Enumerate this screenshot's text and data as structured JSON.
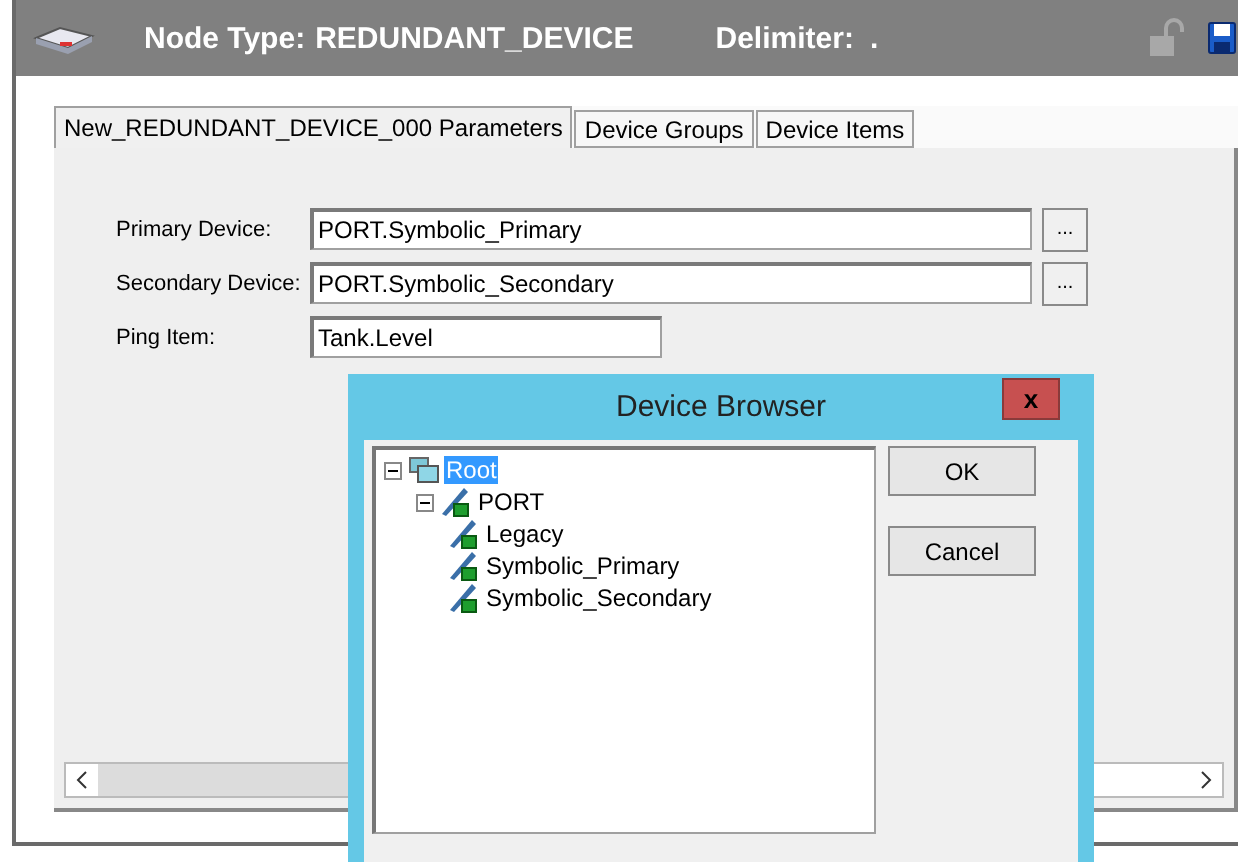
{
  "header": {
    "node_type_label": "Node Type:",
    "node_type": "REDUNDANT_DEVICE",
    "delimiter_label": "Delimiter:",
    "delimiter": "."
  },
  "tabs": [
    {
      "label": "New_REDUNDANT_DEVICE_000 Parameters",
      "selected": true
    },
    {
      "label": "Device Groups",
      "selected": false
    },
    {
      "label": "Device Items",
      "selected": false
    }
  ],
  "fields": [
    {
      "label": "Primary Device:",
      "value": "PORT.Symbolic_Primary",
      "browse": "...",
      "kind": "wide"
    },
    {
      "label": "Secondary Device:",
      "value": "PORT.Symbolic_Secondary",
      "browse": "...",
      "kind": "wide"
    },
    {
      "label": "Ping Item:",
      "value": "Tank.Level",
      "kind": "short"
    }
  ],
  "dialog": {
    "title": "Device Browser",
    "close": "x",
    "tree": [
      {
        "label": "Root",
        "kind": "root",
        "selected": true,
        "expanded": true,
        "children": [
          {
            "label": "PORT",
            "kind": "port",
            "selected": false,
            "expanded": true,
            "children": [
              {
                "label": "Legacy",
                "kind": "device",
                "selected": false
              },
              {
                "label": "Symbolic_Primary",
                "kind": "device",
                "selected": false
              },
              {
                "label": "Symbolic_Secondary",
                "kind": "device",
                "selected": false
              }
            ]
          }
        ]
      }
    ],
    "buttons": [
      "OK",
      "Cancel"
    ]
  }
}
